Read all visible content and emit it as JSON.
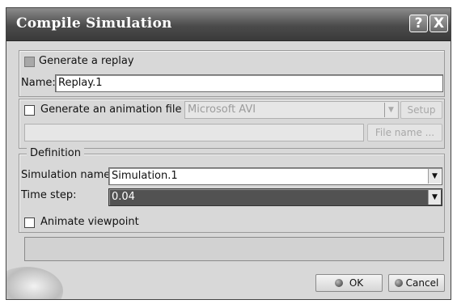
{
  "dialog": {
    "title": "Compile Simulation",
    "help_glyph": "?",
    "close_glyph": "X"
  },
  "replay": {
    "generate_label": "Generate a replay",
    "generate_checked": true,
    "name_label": "Name:",
    "name_value": "Replay.1"
  },
  "animation": {
    "generate_label": "Generate an animation file",
    "generate_checked": false,
    "format_value": "Microsoft AVI",
    "setup_label": "Setup",
    "file_path_value": "",
    "file_name_label": "File name ..."
  },
  "definition": {
    "legend": "Definition",
    "simulation_name_label": "Simulation name:",
    "simulation_name_value": "Simulation.1",
    "time_step_label": "Time step:",
    "time_step_value": "0.04",
    "animate_viewpoint_label": "Animate viewpoint",
    "animate_viewpoint_checked": false
  },
  "status_text": "",
  "footer": {
    "ok_label": "OK",
    "cancel_label": "Cancel"
  },
  "icons": {
    "dropdown": "▼"
  }
}
